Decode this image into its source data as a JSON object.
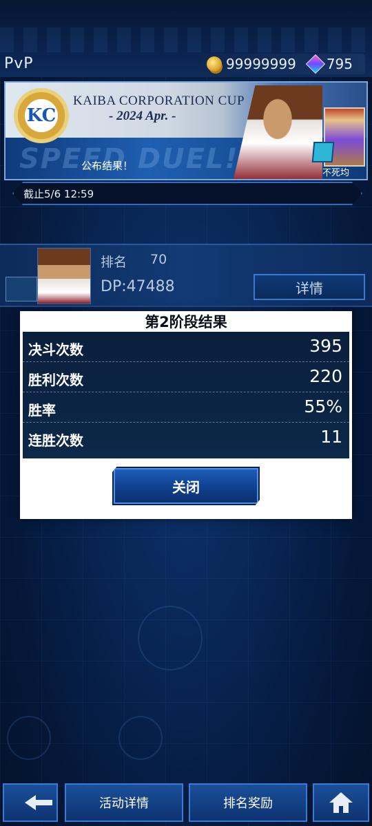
{
  "header": {
    "title": "PvP",
    "gold": "99999999",
    "gems": "795"
  },
  "banner": {
    "logo_text": "KC",
    "title": "KAIBA CORPORATION CUP",
    "date": "- 2024 Apr. -",
    "status": "公布结果！",
    "reward_label": "不死均",
    "background_word": "SPEED DUEL!"
  },
  "deadline": "截止5/6 12:59",
  "player": {
    "rank_label": "排名",
    "rank_value": "70",
    "dp": "DP:47488",
    "detail_button": "详情"
  },
  "modal": {
    "title": "第2阶段结果",
    "stats": [
      {
        "label": "决斗次数",
        "value": "395"
      },
      {
        "label": "胜利次数",
        "value": "220"
      },
      {
        "label": "胜率",
        "value": "55%"
      },
      {
        "label": "连胜次数",
        "value": "11"
      }
    ],
    "close_button": "关闭"
  },
  "bottom_nav": {
    "event_details": "活动详情",
    "rank_rewards": "排名奖励"
  },
  "colors": {
    "background": "#0a2a5c",
    "accent": "#3b7ad4",
    "button": "#103f8c"
  }
}
